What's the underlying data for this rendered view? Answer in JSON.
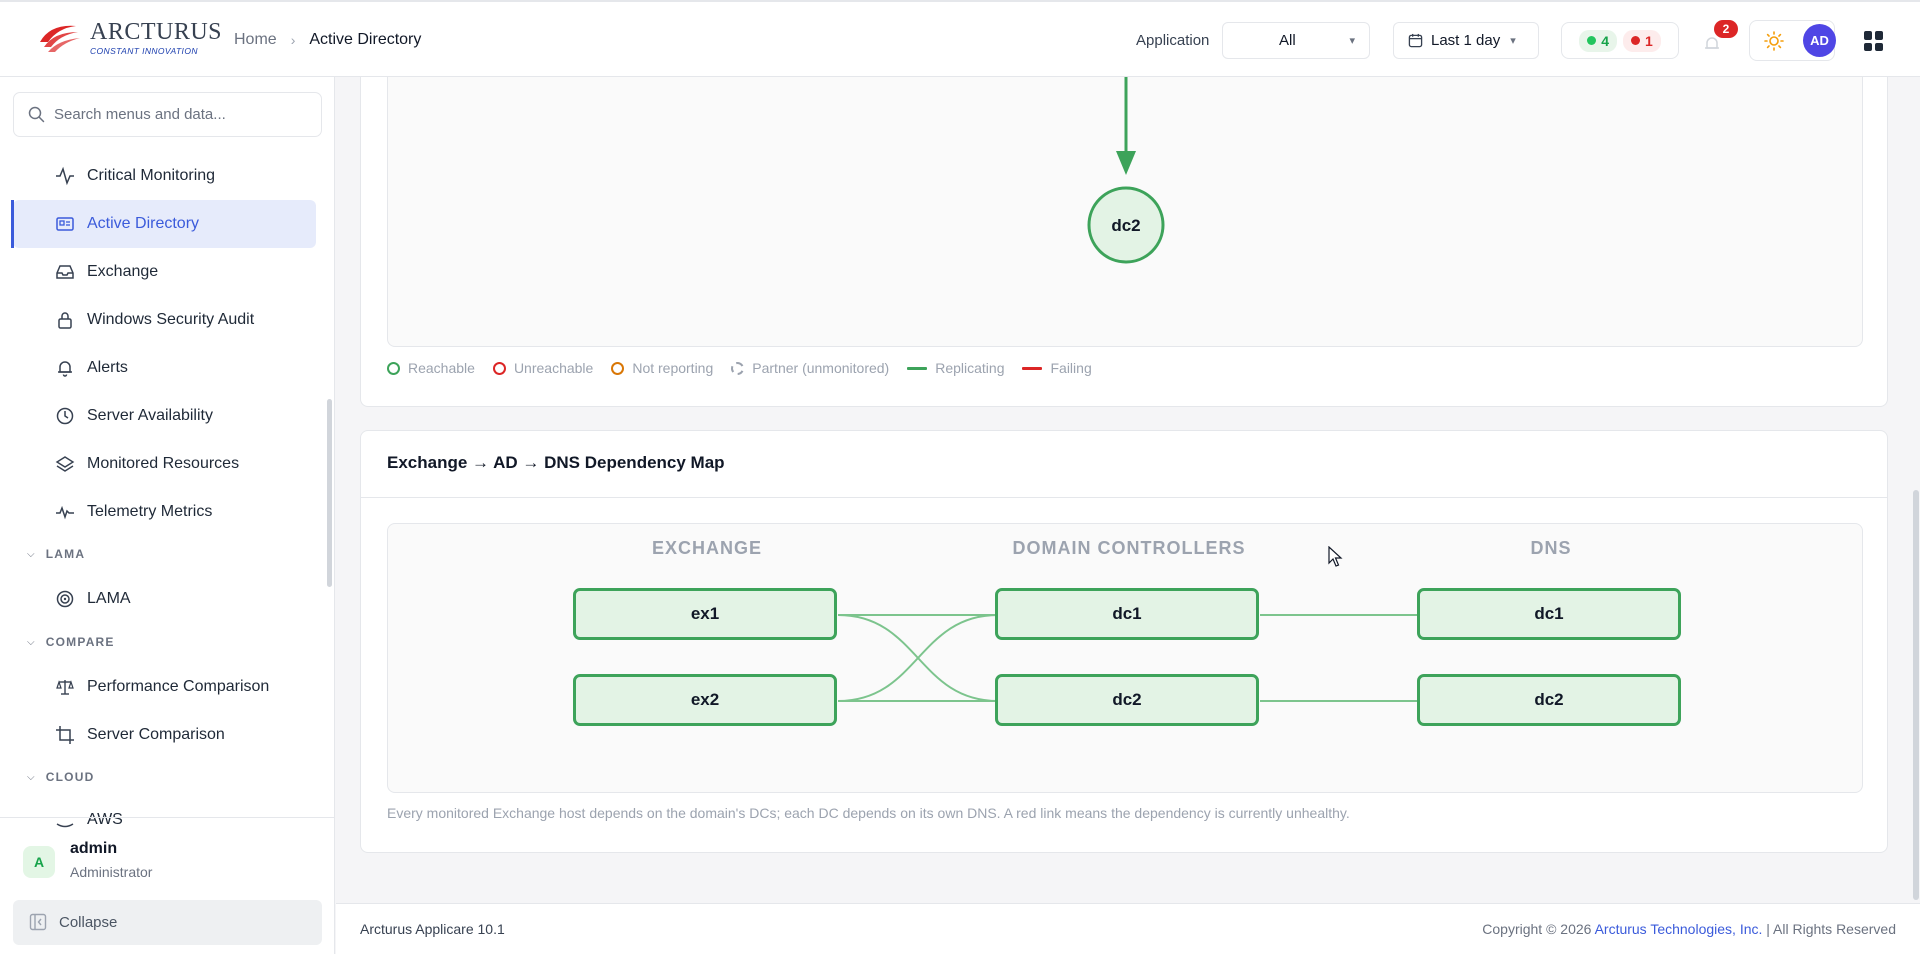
{
  "header": {
    "logo_name": "ARCTURUS",
    "logo_tagline": "CONSTANT INNOVATION",
    "breadcrumb": {
      "home": "Home",
      "current": "Active Directory"
    },
    "application_label": "Application",
    "application_value": "All",
    "date_range": "Last 1 day",
    "status_up_count": "4",
    "status_down_count": "1",
    "notification_count": "2",
    "avatar_initials": "AD",
    "colors": {
      "up": "#16a34a",
      "down": "#dc2626",
      "accent": "#3b5bdb"
    }
  },
  "sidebar": {
    "search_placeholder": "Search menus and data...",
    "items": [
      {
        "label": "Critical Monitoring",
        "icon": "activity-icon"
      },
      {
        "label": "Active Directory",
        "icon": "directory-card-icon",
        "active": true
      },
      {
        "label": "Exchange",
        "icon": "inbox-icon"
      },
      {
        "label": "Windows Security Audit",
        "icon": "lock-icon"
      },
      {
        "label": "Alerts",
        "icon": "bell-icon"
      },
      {
        "label": "Server Availability",
        "icon": "clock-icon"
      },
      {
        "label": "Monitored Resources",
        "icon": "layers-icon"
      },
      {
        "label": "Telemetry Metrics",
        "icon": "pulse-icon"
      }
    ],
    "sections": {
      "lama": {
        "title": "LAMA",
        "items": [
          {
            "label": "LAMA",
            "icon": "target-icon"
          }
        ]
      },
      "compare": {
        "title": "COMPARE",
        "items": [
          {
            "label": "Performance Comparison",
            "icon": "scale-icon"
          },
          {
            "label": "Server Comparison",
            "icon": "crop-icon"
          }
        ]
      },
      "cloud": {
        "title": "CLOUD",
        "items": [
          {
            "label": "AWS",
            "icon": "aws-icon"
          }
        ]
      }
    },
    "user": {
      "initial": "A",
      "name": "admin",
      "role": "Administrator"
    },
    "collapse_label": "Collapse"
  },
  "topology": {
    "node": "dc2",
    "legend": {
      "reachable": "Reachable",
      "unreachable": "Unreachable",
      "not_reporting": "Not reporting",
      "partner": "Partner (unmonitored)",
      "replicating": "Replicating",
      "failing": "Failing"
    },
    "colors": {
      "reachable": "#3da35a",
      "unreachable": "#dc2626",
      "not_reporting": "#d97706",
      "partner": "#9ca3af",
      "replicating": "#3da35a",
      "failing": "#dc2626"
    }
  },
  "dependency_map": {
    "title": "Exchange → AD → DNS Dependency Map",
    "columns": {
      "exchange": "EXCHANGE",
      "dcs": "DOMAIN CONTROLLERS",
      "dns": "DNS"
    },
    "exchange_nodes": [
      "ex1",
      "ex2"
    ],
    "dc_nodes": [
      "dc1",
      "dc2"
    ],
    "dns_nodes": [
      "dc1",
      "dc2"
    ],
    "note": "Every monitored Exchange host depends on the domain's DCs; each DC depends on its own DNS. A red link means the dependency is currently unhealthy."
  },
  "footer": {
    "version": "Arcturus Applicare 10.1",
    "copyright_prefix": "Copyright © 2026 ",
    "company": "Arcturus Technologies, Inc.",
    "rights": " | All Rights Reserved"
  }
}
